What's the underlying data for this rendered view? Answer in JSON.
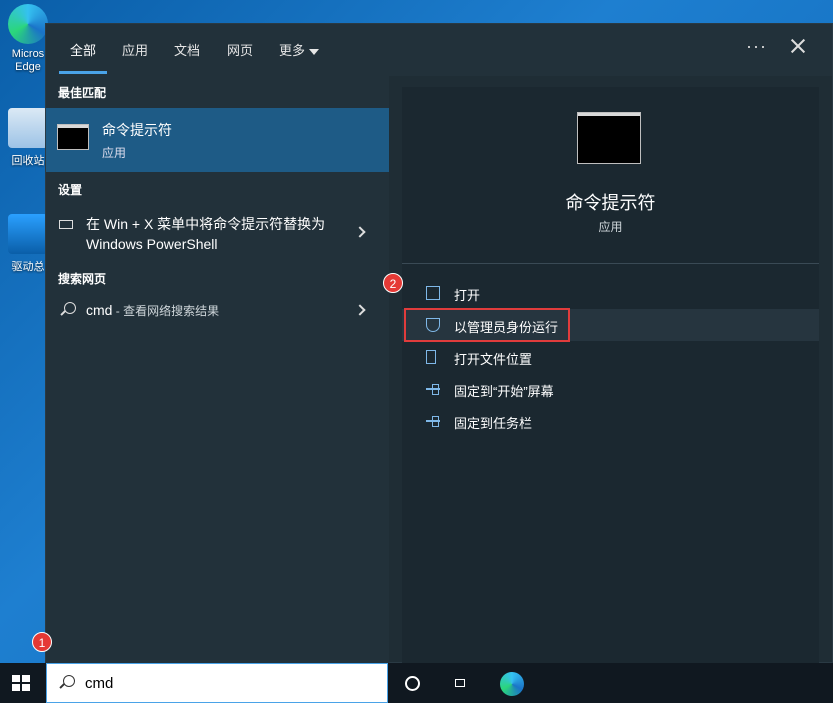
{
  "desktop": {
    "icons": [
      {
        "label": "Micros Edge"
      },
      {
        "label": "回收站"
      },
      {
        "label": "驱动总"
      }
    ]
  },
  "tabs": [
    {
      "label": "全部"
    },
    {
      "label": "应用"
    },
    {
      "label": "文档"
    },
    {
      "label": "网页"
    },
    {
      "label": "更多"
    }
  ],
  "header": {
    "more_options": "···"
  },
  "left": {
    "best_match_title": "最佳匹配",
    "best_match": {
      "name": "命令提示符",
      "type": "应用"
    },
    "settings_title": "设置",
    "setting_item": "在 Win + X 菜单中将命令提示符替换为 Windows PowerShell",
    "web_title": "搜索网页",
    "web_query": "cmd",
    "web_suffix": " - 查看网络搜索结果"
  },
  "right": {
    "app_name": "命令提示符",
    "app_type": "应用",
    "actions": [
      {
        "label": "打开",
        "icon": "open-icon"
      },
      {
        "label": "以管理员身份运行",
        "icon": "shield-icon"
      },
      {
        "label": "打开文件位置",
        "icon": "folder-icon"
      },
      {
        "label": "固定到“开始”屏幕",
        "icon": "pin-icon"
      },
      {
        "label": "固定到任务栏",
        "icon": "pin-icon"
      }
    ]
  },
  "annotations": {
    "badge1": "1",
    "badge2": "2",
    "color": "#e03c3c"
  },
  "taskbar": {
    "search_value": "cmd"
  }
}
